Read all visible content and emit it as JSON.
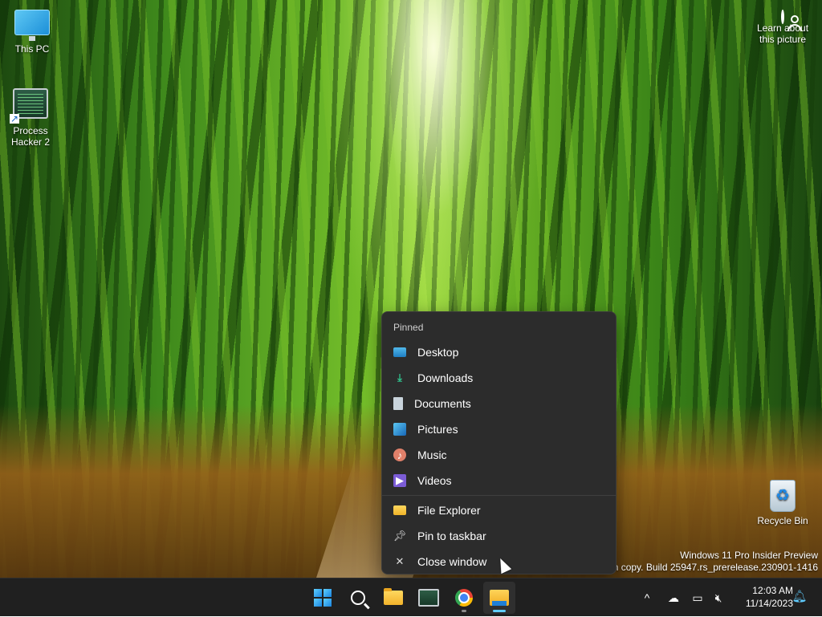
{
  "desktop": {
    "icons": [
      {
        "label": "This PC",
        "icon": "monitor-icon"
      },
      {
        "label": "Process Hacker 2",
        "icon": "process-hacker-icon"
      },
      {
        "label": "Recycle Bin",
        "icon": "recycle-bin-icon"
      }
    ],
    "learn": {
      "label": "Learn about this picture",
      "icon": "user-circle-icon"
    },
    "watermark": {
      "line1": "Windows 11 Pro Insider Preview",
      "line2": "ion copy. Build 25947.rs_prerelease.230901-1416"
    }
  },
  "jumplist": {
    "header": "Pinned",
    "pinned": [
      {
        "label": "Desktop",
        "icon": "desktop-folder-icon"
      },
      {
        "label": "Downloads",
        "icon": "download-icon"
      },
      {
        "label": "Documents",
        "icon": "document-icon"
      },
      {
        "label": "Pictures",
        "icon": "pictures-icon"
      },
      {
        "label": "Music",
        "icon": "music-icon"
      },
      {
        "label": "Videos",
        "icon": "video-icon"
      }
    ],
    "actions": [
      {
        "label": "File Explorer",
        "icon": "folder-icon"
      },
      {
        "label": "Pin to taskbar",
        "icon": "pin-icon"
      },
      {
        "label": "Close window",
        "icon": "close-icon"
      }
    ]
  },
  "taskbar": {
    "apps": [
      {
        "name": "start",
        "icon": "windows-logo-icon"
      },
      {
        "name": "search",
        "icon": "search-icon"
      },
      {
        "name": "file-manager",
        "icon": "folder-icon"
      },
      {
        "name": "process-hacker",
        "icon": "process-hacker-icon"
      },
      {
        "name": "chrome",
        "icon": "chrome-icon"
      },
      {
        "name": "file-explorer",
        "icon": "file-explorer-icon"
      }
    ],
    "tray": {
      "chevron": "^",
      "time": "12:03 AM",
      "date": "11/14/2023"
    }
  },
  "colors": {
    "taskbar_bg": "#202020",
    "menu_bg": "#2c2c2c",
    "accent": "#60cdff"
  }
}
